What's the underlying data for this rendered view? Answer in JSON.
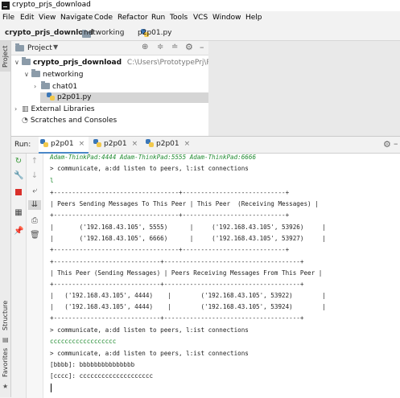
{
  "window": {
    "title": "crypto_prjs_download"
  },
  "menu": [
    "File",
    "Edit",
    "View",
    "Navigate",
    "Code",
    "Refactor",
    "Run",
    "Tools",
    "VCS",
    "Window",
    "Help"
  ],
  "breadcrumb": [
    "crypto_prjs_download",
    "networking",
    "p2p01.py"
  ],
  "sidebar": {
    "project_tab": "Project",
    "structure_tab": "Structure",
    "favorites_tab": "Favorites"
  },
  "project": {
    "header_label": "Project",
    "root_name": "crypto_prjs_download",
    "root_path": "C:\\Users\\PrototypePrj\\PycharmP",
    "folder": "networking",
    "subfolder": "chat01",
    "file": "p2p01.py",
    "external": "External Libraries",
    "scratches": "Scratches and Consoles"
  },
  "run": {
    "label": "Run:",
    "tabs": [
      "p2p01",
      "p2p01",
      "p2p01"
    ]
  },
  "console": {
    "lines": [
      {
        "text": "Adam-ThinkPad:4444 Adam-ThinkPad:5555 Adam-ThinkPad:6666",
        "style": "green italic"
      },
      {
        "text": "> communicate, a:dd listen to peers, l:ist connections",
        "style": ""
      },
      {
        "text": "l",
        "style": "green"
      },
      {
        "text": "+----------------------------------+----------------------------+",
        "style": ""
      },
      {
        "text": "| Peers Sending Messages To This Peer | This Peer  (Receiving Messages) |",
        "style": ""
      },
      {
        "text": "+----------------------------------+----------------------------+",
        "style": ""
      },
      {
        "text": "|       ('192.168.43.105', 5555)      |     ('192.168.43.105', 53926)     |",
        "style": ""
      },
      {
        "text": "|       ('192.168.43.105', 6666)      |     ('192.168.43.105', 53927)     |",
        "style": ""
      },
      {
        "text": "+----------------------------------+----------------------------+",
        "style": ""
      },
      {
        "text": "+-----------------------------+-------------------------------------+",
        "style": ""
      },
      {
        "text": "| This Peer (Sending Messages) | Peers Receiving Messages From This Peer |",
        "style": ""
      },
      {
        "text": "+-----------------------------+-------------------------------------+",
        "style": ""
      },
      {
        "text": "|   ('192.168.43.105', 4444)    |        ('192.168.43.105', 53922)        |",
        "style": ""
      },
      {
        "text": "|   ('192.168.43.105', 4444)    |        ('192.168.43.105', 53924)        |",
        "style": ""
      },
      {
        "text": "+-----------------------------+-------------------------------------+",
        "style": ""
      },
      {
        "text": "> communicate, a:dd listen to peers, l:ist connections",
        "style": ""
      },
      {
        "text": "cccccccccccccccccc",
        "style": "green"
      },
      {
        "text": "> communicate, a:dd listen to peers, l:ist connections",
        "style": ""
      },
      {
        "text": "[bbbb]: bbbbbbbbbbbbbbb",
        "style": ""
      },
      {
        "text": "[cccc]: cccccccccccccccccccc",
        "style": ""
      }
    ]
  }
}
